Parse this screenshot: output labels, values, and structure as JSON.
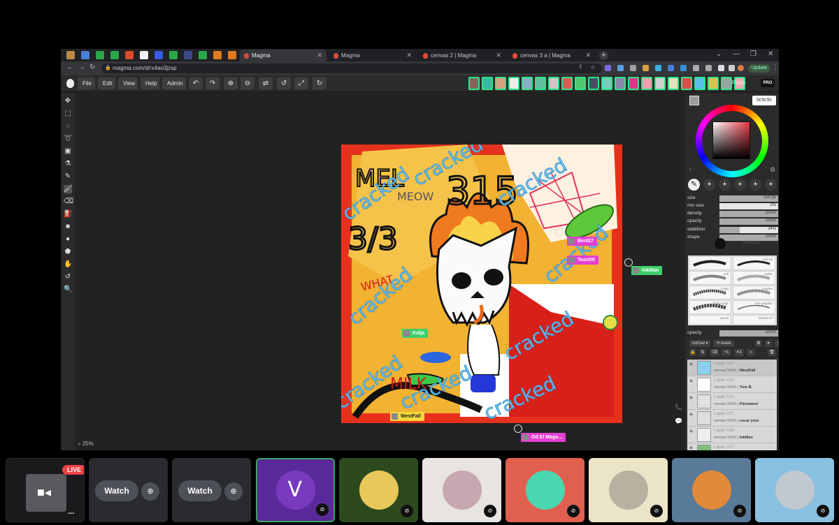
{
  "browser": {
    "tabs": [
      {
        "title": "Magma",
        "active": true
      },
      {
        "title": "Magma",
        "active": false
      },
      {
        "title": "cenvas 2 | Magma",
        "active": false
      },
      {
        "title": "cenvas 3 a | Magma",
        "active": false
      }
    ],
    "new_tab": "+",
    "url": "magma.com/d/rx4ao3jzsp",
    "update_label": "Update"
  },
  "app": {
    "menu": [
      "File",
      "Edit",
      "View",
      "Help",
      "Admin"
    ],
    "user_name": "Fimix",
    "pro_badge": "PRO",
    "zoom": "25%",
    "color_hex": "9c9c9c",
    "cursors": [
      {
        "name": "Benl27",
        "color": "#e43fd4"
      },
      {
        "name": "Toastttt",
        "color": "#e43fd4"
      },
      {
        "name": "InkMan",
        "color": "#3fcf6a"
      },
      {
        "name": "Kolja",
        "color": "#3fcf6a"
      },
      {
        "name": "WestFall",
        "color": "#f4d93a"
      },
      {
        "name": "Od El Mago...",
        "color": "#e43fd4"
      }
    ],
    "brush_props": [
      {
        "label": "size",
        "value": "100 px",
        "level": 1.0
      },
      {
        "label": "min size",
        "value": "0%",
        "level": 0.0
      },
      {
        "label": "density",
        "value": "100%",
        "level": 1.0
      },
      {
        "label": "opacity",
        "value": "100%",
        "level": 1.0
      },
      {
        "label": "stabilizer",
        "value": "34%",
        "level": 0.34
      },
      {
        "label": "shape",
        "value": "100%",
        "level": 1.0
      }
    ],
    "brush_names": [
      "",
      "soft ink",
      "soft",
      "softer",
      "rough",
      "rougher",
      "thick rough",
      "thin graphite",
      "pencil",
      "soft pencil"
    ],
    "hardness_label": "hardness",
    "layer_opacity": {
      "label": "opacity",
      "value": "100%"
    },
    "blend_mode": "normal",
    "leave_label": "leave",
    "layers": [
      {
        "name": "Layer #23",
        "meta": "normal 100% | ",
        "owner": "WestFall"
      },
      {
        "name": "Layer #22",
        "meta": "normal 100% | ",
        "owner": "Tom B."
      },
      {
        "name": "Layer #21",
        "meta": "normal 100% | ",
        "owner": "Firemanst"
      },
      {
        "name": "Layer #20",
        "meta": "normal 100% | ",
        "owner": "cecar jono"
      },
      {
        "name": "Layer #18",
        "meta": "normal 100% | ",
        "owner": "InkMan"
      },
      {
        "name": "Layer #17",
        "meta": "",
        "owner": ""
      }
    ]
  },
  "call": {
    "live_label": "LIVE",
    "watch_label": "Watch",
    "more": "..."
  }
}
